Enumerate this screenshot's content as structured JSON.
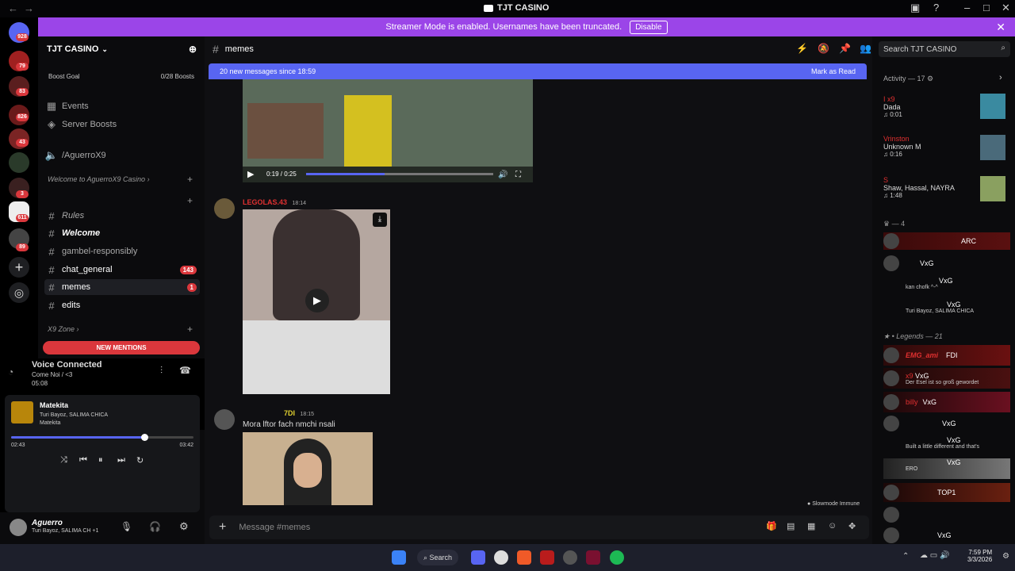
{
  "window": {
    "title": "TJT CASINO"
  },
  "banner": {
    "text": "Streamer Mode is enabled. Usernames have been truncated.",
    "disable": "Disable"
  },
  "guild_badges": [
    "928",
    "79",
    "83",
    "826",
    "43",
    "3",
    "611",
    "89"
  ],
  "server": {
    "name": "TJT CASINO",
    "boost_goal": "Boost Goal",
    "boosts": "0/28 Boosts"
  },
  "sidebar": {
    "events": "Events",
    "server_boosts": "Server Boosts",
    "voice_ch": "/AguerroX9",
    "welcome_cat": "Welcome to AguerroX9 Casino",
    "rules": "Rules",
    "welcome": "Welcome",
    "gambel": "gambel-responsibly",
    "chat_general": "chat_general",
    "chat_badge": "143",
    "memes": "memes",
    "memes_badge": "1",
    "edits": "edits",
    "x9zone": "X9 Zone",
    "new_mentions": "NEW MENTIONS"
  },
  "voice": {
    "status": "Voice Connected",
    "channel": "Come Noi / <3",
    "time": "05:08"
  },
  "player": {
    "title": "Matekita",
    "artist": "Turi Bayoz, SALIMA CHICA",
    "album": "Matekita",
    "elapsed": "02:43",
    "total": "03:42",
    "progress": 0.73
  },
  "user": {
    "name": "Aguerro",
    "status": "Turi Bayoz, SALIMA CH +1"
  },
  "chat": {
    "channel": "memes",
    "new_messages": "20 new messages since 18:59",
    "mark_read": "Mark as Read",
    "video_time": "0:19 / 0:25",
    "msg1_user": "LEGOLAS.43",
    "msg1_time": "18:14",
    "msg2_user": "7DI",
    "msg2_time": "18:15",
    "msg2_text": "Mora lftor fach nmchi nsali",
    "slowmode": "Slowmode Immune",
    "placeholder": "Message #memes"
  },
  "members": {
    "search": "Search TJT CASINO",
    "activity_header": "Activity — 17",
    "activities": [
      {
        "name": "I x9",
        "song": "Dada",
        "time": "0:01"
      },
      {
        "name": "Vrinston",
        "song": "Unknown M",
        "time": "0:16"
      },
      {
        "name": "S",
        "song": "Shaw, Hassal, NAYRA",
        "time": "1:48"
      }
    ],
    "group1_header": "— 4",
    "group1": [
      {
        "tag": "ARC",
        "status": ""
      },
      {
        "tag": "VxG",
        "status": ""
      },
      {
        "tag": "VxG",
        "status": "kan chofk ^-^"
      },
      {
        "tag": "VxG",
        "status": "Turi Bayoz, SALIMA CHICA"
      }
    ],
    "legends_header": "Legends — 21",
    "legends": [
      {
        "name": "EMG_ami",
        "tag": "FDI",
        "status": ""
      },
      {
        "name": "x9",
        "tag": "VxG",
        "status": "Der Esel ist so groß gewordet"
      },
      {
        "name": "billy",
        "tag": "VxG",
        "status": ""
      },
      {
        "name": "",
        "tag": "VxG",
        "status": ""
      },
      {
        "name": "",
        "tag": "VxG",
        "status": "Built a little different and that's"
      },
      {
        "name": "",
        "tag": "VxG",
        "status": "ERO"
      },
      {
        "name": "",
        "tag": "TOP1",
        "status": ""
      },
      {
        "name": "",
        "tag": "",
        "status": ""
      },
      {
        "name": "",
        "tag": "VxG",
        "status": ""
      }
    ]
  },
  "taskbar": {
    "search": "Search",
    "time": "7:59 PM",
    "date": "3/3/2026"
  }
}
